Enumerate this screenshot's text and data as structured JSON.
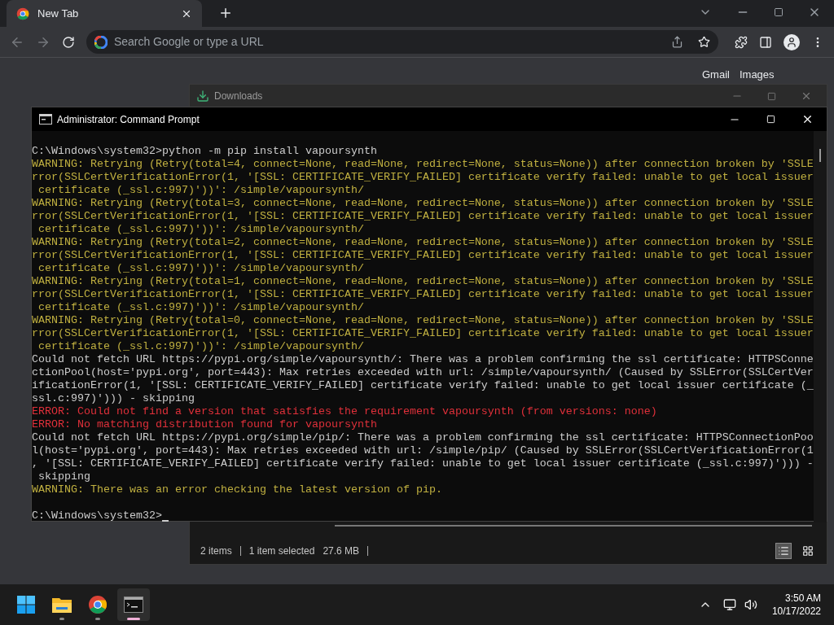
{
  "browser": {
    "tab": {
      "title": "New Tab",
      "selected": true
    },
    "omnibox": {
      "placeholder": "Search Google or type a URL"
    },
    "page_links": [
      "Gmail",
      "Images"
    ]
  },
  "downloads_window": {
    "title": "Downloads",
    "status_bar": {
      "items": "2 items",
      "selection": "1 item selected",
      "size": "27.6 MB"
    },
    "views": [
      {
        "kind": "details",
        "selected": true
      },
      {
        "kind": "tiles",
        "selected": false
      }
    ]
  },
  "console": {
    "title": "Administrator: Command Prompt",
    "lines": [
      {
        "kind": "normal",
        "text": "C:\\Windows\\system32>python -m pip install vapoursynth"
      },
      {
        "kind": "warning",
        "text": "WARNING: Retrying (Retry(total=4, connect=None, read=None, redirect=None, status=None)) after connection broken by 'SSLE"
      },
      {
        "kind": "warning",
        "text": "rror(SSLCertVerificationError(1, '[SSL: CERTIFICATE_VERIFY_FAILED] certificate verify failed: unable to get local issuer"
      },
      {
        "kind": "warning",
        "text": " certificate (_ssl.c:997)'))': /simple/vapoursynth/"
      },
      {
        "kind": "warning",
        "text": "WARNING: Retrying (Retry(total=3, connect=None, read=None, redirect=None, status=None)) after connection broken by 'SSLE"
      },
      {
        "kind": "warning",
        "text": "rror(SSLCertVerificationError(1, '[SSL: CERTIFICATE_VERIFY_FAILED] certificate verify failed: unable to get local issuer"
      },
      {
        "kind": "warning",
        "text": " certificate (_ssl.c:997)'))': /simple/vapoursynth/"
      },
      {
        "kind": "warning",
        "text": "WARNING: Retrying (Retry(total=2, connect=None, read=None, redirect=None, status=None)) after connection broken by 'SSLE"
      },
      {
        "kind": "warning",
        "text": "rror(SSLCertVerificationError(1, '[SSL: CERTIFICATE_VERIFY_FAILED] certificate verify failed: unable to get local issuer"
      },
      {
        "kind": "warning",
        "text": " certificate (_ssl.c:997)'))': /simple/vapoursynth/"
      },
      {
        "kind": "warning",
        "text": "WARNING: Retrying (Retry(total=1, connect=None, read=None, redirect=None, status=None)) after connection broken by 'SSLE"
      },
      {
        "kind": "warning",
        "text": "rror(SSLCertVerificationError(1, '[SSL: CERTIFICATE_VERIFY_FAILED] certificate verify failed: unable to get local issuer"
      },
      {
        "kind": "warning",
        "text": " certificate (_ssl.c:997)'))': /simple/vapoursynth/"
      },
      {
        "kind": "warning",
        "text": "WARNING: Retrying (Retry(total=0, connect=None, read=None, redirect=None, status=None)) after connection broken by 'SSLE"
      },
      {
        "kind": "warning",
        "text": "rror(SSLCertVerificationError(1, '[SSL: CERTIFICATE_VERIFY_FAILED] certificate verify failed: unable to get local issuer"
      },
      {
        "kind": "warning",
        "text": " certificate (_ssl.c:997)'))': /simple/vapoursynth/"
      },
      {
        "kind": "normal",
        "text": "Could not fetch URL https://pypi.org/simple/vapoursynth/: There was a problem confirming the ssl certificate: HTTPSConne"
      },
      {
        "kind": "normal",
        "text": "ctionPool(host='pypi.org', port=443): Max retries exceeded with url: /simple/vapoursynth/ (Caused by SSLError(SSLCertVer"
      },
      {
        "kind": "normal",
        "text": "ificationError(1, '[SSL: CERTIFICATE_VERIFY_FAILED] certificate verify failed: unable to get local issuer certificate (_"
      },
      {
        "kind": "normal",
        "text": "ssl.c:997)'))) - skipping"
      },
      {
        "kind": "error",
        "text": "ERROR: Could not find a version that satisfies the requirement vapoursynth (from versions: none)"
      },
      {
        "kind": "error",
        "text": "ERROR: No matching distribution found for vapoursynth"
      },
      {
        "kind": "normal",
        "text": "Could not fetch URL https://pypi.org/simple/pip/: There was a problem confirming the ssl certificate: HTTPSConnectionPoo"
      },
      {
        "kind": "normal",
        "text": "l(host='pypi.org', port=443): Max retries exceeded with url: /simple/pip/ (Caused by SSLError(SSLCertVerificationError(1"
      },
      {
        "kind": "normal",
        "text": ", '[SSL: CERTIFICATE_VERIFY_FAILED] certificate verify failed: unable to get local issuer certificate (_ssl.c:997)'))) -"
      },
      {
        "kind": "normal",
        "text": " skipping"
      },
      {
        "kind": "warning",
        "text": "WARNING: There was an error checking the latest version of pip."
      },
      {
        "kind": "prompt",
        "text": "C:\\Windows\\system32>"
      }
    ]
  },
  "taskbar": {
    "apps": [
      {
        "kind": "folder",
        "running": true,
        "active": false
      },
      {
        "kind": "browser",
        "running": true,
        "active": false
      },
      {
        "kind": "terminal",
        "running": true,
        "active": true
      }
    ],
    "clock": {
      "time": "3:50 AM",
      "date": "10/17/2022"
    }
  }
}
